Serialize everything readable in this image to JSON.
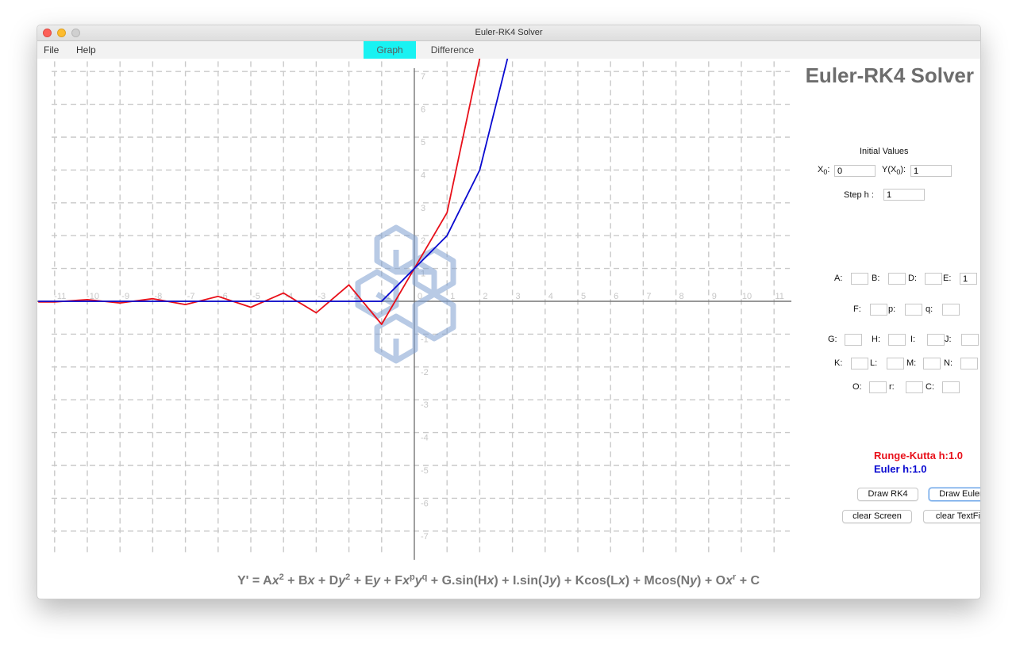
{
  "window": {
    "title": "Euler-RK4 Solver"
  },
  "menu": {
    "file": "File",
    "help": "Help"
  },
  "tabs": [
    {
      "label": "Graph",
      "active": true
    },
    {
      "label": "Difference",
      "active": false
    }
  ],
  "app_title": "Euler-RK4 Solver",
  "initial_values": {
    "heading": "Initial Values",
    "x0_label": "X",
    "x0_sub": "0",
    "x0_suffix": ":",
    "x0_value": "0",
    "y0_label_pre": "Y(X",
    "y0_sub": "0",
    "y0_label_post": "):",
    "y0_value": "1",
    "step_label": "Step  h :",
    "step_value": "1"
  },
  "coefficients": [
    {
      "label": "A:",
      "value": ""
    },
    {
      "label": "B:",
      "value": ""
    },
    {
      "label": "D:",
      "value": ""
    },
    {
      "label": "E:",
      "value": "1"
    },
    {
      "label": "F:",
      "value": ""
    },
    {
      "label": "p:",
      "value": ""
    },
    {
      "label": "q:",
      "value": ""
    },
    {
      "label": "G:",
      "value": ""
    },
    {
      "label": "H:",
      "value": ""
    },
    {
      "label": "I:",
      "value": ""
    },
    {
      "label": "J:",
      "value": ""
    },
    {
      "label": "K:",
      "value": ""
    },
    {
      "label": "L:",
      "value": ""
    },
    {
      "label": "M:",
      "value": ""
    },
    {
      "label": "N:",
      "value": ""
    },
    {
      "label": "O:",
      "value": ""
    },
    {
      "label": "r:",
      "value": ""
    },
    {
      "label": "C:",
      "value": ""
    }
  ],
  "legend": {
    "rk_label": "Runge-Kutta  h:1.0",
    "euler_label": "Euler     h:1.0",
    "rk_color": "#e8101a",
    "euler_color": "#0a0ad0"
  },
  "buttons": {
    "draw_rk4": "Draw RK4",
    "draw_euler": "Draw Euler",
    "clear_screen": "clear Screen",
    "clear_textfields": "clear TextFields"
  },
  "equation": {
    "lhs": "Y' = ",
    "t1": "A",
    "x1": "x",
    "e1": "2",
    "t2": " + B",
    "x2": "x",
    "t3": " + D",
    "y3": "y",
    "e3": "2",
    "t4": " + E",
    "y4": "y",
    "t5": " + F",
    "x5": "x",
    "p5": "p",
    "y5": "y",
    "q5": "q",
    "t6": " + G.sin(H",
    "x6": "x",
    "c6": ")",
    "t7": " + I.sin(J",
    "y7": "y",
    "c7": ")",
    "t8": " + Kcos(L",
    "x8": "x",
    "c8": ")",
    "t9": " + Mcos(N",
    "y9": "y",
    "c9": ")",
    "t10": " + O",
    "x10": "x",
    "r10": "r",
    "t11": " + C"
  },
  "chart_data": {
    "type": "line",
    "grid": true,
    "xlim": [
      -11.5,
      11.5
    ],
    "ylim": [
      -7.6,
      7.6
    ],
    "x_ticks": [
      -11,
      -10,
      -9,
      -8,
      -7,
      -6,
      -5,
      -4,
      -3,
      -2,
      -1,
      0,
      1,
      2,
      3,
      4,
      5,
      6,
      7,
      8,
      9,
      10,
      11
    ],
    "y_ticks": [
      -7,
      -6,
      -5,
      -4,
      -3,
      -2,
      -1,
      1,
      2,
      3,
      4,
      5,
      6,
      7
    ],
    "x_tick_labels": [
      "-11",
      "-10",
      "-9",
      "-8",
      "-7",
      "-6",
      "-5",
      "-4",
      "-3",
      "-2",
      "-1",
      "0",
      "1",
      "2",
      "3",
      "4",
      "5",
      "6",
      "7",
      "8",
      "9",
      "10",
      "11"
    ],
    "y_tick_labels": [
      "-7",
      "-6",
      "-5",
      "-4",
      "-3",
      "-2",
      "-1",
      "1",
      "2",
      "3",
      "4",
      "5",
      "6",
      "7"
    ],
    "series": [
      {
        "name": "Runge-Kutta",
        "color": "#e8101a",
        "x": [
          -11.5,
          -11,
          -10,
          -9,
          -8,
          -7,
          -6,
          -5,
          -4,
          -3,
          -2,
          -1,
          0,
          1,
          2,
          2.1
        ],
        "y": [
          -0.02,
          -0.02,
          0.05,
          -0.05,
          0.08,
          -0.1,
          0.15,
          -0.18,
          0.25,
          -0.35,
          0.5,
          -0.7,
          1,
          2.7,
          7.4,
          9
        ]
      },
      {
        "name": "Euler",
        "color": "#0a0ad0",
        "x": [
          -11.5,
          -11,
          -10,
          -9,
          -8,
          -7,
          -6,
          -5,
          -4,
          -3,
          -2,
          -1,
          0,
          1,
          2,
          3,
          3.2
        ],
        "y": [
          0,
          0,
          0,
          0,
          0,
          0,
          0,
          0,
          0,
          0,
          0,
          0,
          1,
          2,
          4,
          8,
          9
        ]
      }
    ]
  }
}
